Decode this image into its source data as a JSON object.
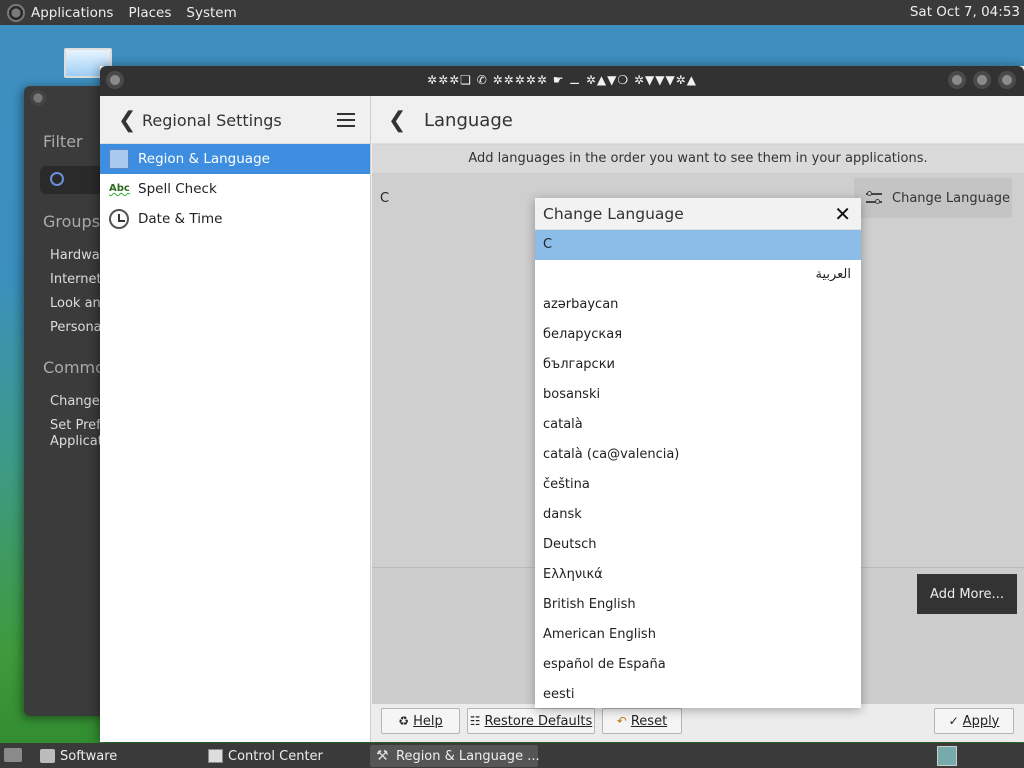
{
  "top_panel": {
    "menus": [
      "Applications",
      "Places",
      "System"
    ],
    "clock": "Sat Oct  7, 04:53"
  },
  "back_window": {
    "filter_label": "Filter",
    "groups_label": "Groups",
    "group_items": [
      "Hardwar",
      "Internet a",
      "Look and",
      "Personal"
    ],
    "common_label": "Commo",
    "common_items": [
      "Change T",
      "Set Prefe",
      "Applicatio"
    ]
  },
  "main_window": {
    "title": "✲✲✲❏ ✆ ✲✲✲✲✲ ☛ ⚊ ✲▲▼❍ ✲▼▼▼✲▲",
    "left": {
      "header_title": "Regional Settings",
      "items": [
        {
          "label": "Region & Language",
          "icon": "region-icon",
          "selected": true
        },
        {
          "label": "Spell Check",
          "icon": "spellcheck-icon",
          "icon_text": "Abc",
          "selected": false
        },
        {
          "label": "Date & Time",
          "icon": "clock-icon",
          "selected": false
        }
      ]
    },
    "right": {
      "header_title": "Language",
      "info_text": "Add languages in the order you want to see them in your applications.",
      "current_language": "C",
      "change_language_button": "Change Language",
      "add_more_button": "Add More..."
    },
    "buttons": {
      "help": "Help",
      "restore_defaults": "Restore Defaults",
      "reset": "Reset",
      "apply": "Apply"
    }
  },
  "dialog": {
    "title": "Change Language",
    "close_glyph": "✕",
    "languages": [
      "C",
      "العربية",
      "azərbaycan",
      "беларуская",
      "български",
      "bosanski",
      "català",
      "català (ca@valencia)",
      "čeština",
      "dansk",
      "Deutsch",
      "Ελληνικά",
      "British English",
      "American English",
      "español de España",
      "eesti"
    ],
    "selected_index": 0
  },
  "taskbar": {
    "tasks": [
      {
        "label": "Software",
        "icon": "software-icon"
      },
      {
        "label": "Control Center",
        "icon": "control-center-icon"
      },
      {
        "label": "Region & Language ...",
        "icon": "tools-icon",
        "active": true
      }
    ]
  }
}
